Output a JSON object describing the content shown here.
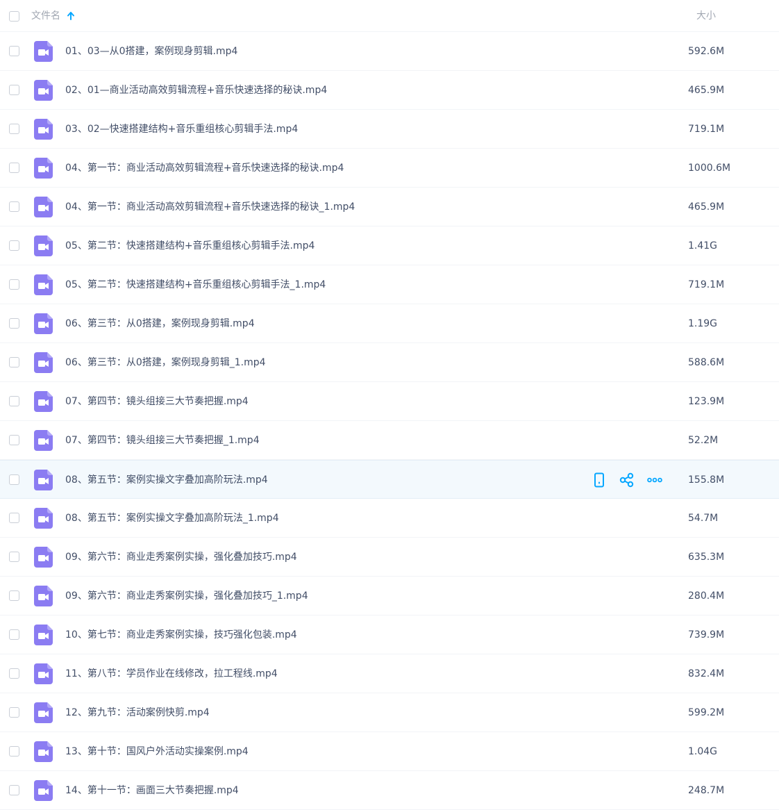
{
  "header": {
    "name_label": "文件名",
    "size_label": "大小",
    "sort_icon": "arrow-up-icon"
  },
  "colors": {
    "accent": "#06a7ff",
    "video_icon": "#8b7cf2",
    "hover_row": "#f3f9fd"
  },
  "files": [
    {
      "name": "01、03—从0搭建，案例现身剪辑.mp4",
      "size": "592.6M"
    },
    {
      "name": "02、01—商业活动高效剪辑流程+音乐快速选择的秘诀.mp4",
      "size": "465.9M"
    },
    {
      "name": "03、02—快速搭建结构+音乐重组核心剪辑手法.mp4",
      "size": "719.1M"
    },
    {
      "name": "04、第一节：商业活动高效剪辑流程+音乐快速选择的秘诀.mp4",
      "size": "1000.6M"
    },
    {
      "name": "04、第一节：商业活动高效剪辑流程+音乐快速选择的秘诀_1.mp4",
      "size": "465.9M"
    },
    {
      "name": "05、第二节：快速搭建结构+音乐重组核心剪辑手法.mp4",
      "size": "1.41G"
    },
    {
      "name": "05、第二节：快速搭建结构+音乐重组核心剪辑手法_1.mp4",
      "size": "719.1M"
    },
    {
      "name": "06、第三节：从0搭建，案例现身剪辑.mp4",
      "size": "1.19G"
    },
    {
      "name": "06、第三节：从0搭建，案例现身剪辑_1.mp4",
      "size": "588.6M"
    },
    {
      "name": "07、第四节：镜头组接三大节奏把握.mp4",
      "size": "123.9M"
    },
    {
      "name": "07、第四节：镜头组接三大节奏把握_1.mp4",
      "size": "52.2M"
    },
    {
      "name": "08、第五节：案例实操文字叠加高阶玩法.mp4",
      "size": "155.8M",
      "hover": true
    },
    {
      "name": "08、第五节：案例实操文字叠加高阶玩法_1.mp4",
      "size": "54.7M"
    },
    {
      "name": "09、第六节：商业走秀案例实操，强化叠加技巧.mp4",
      "size": "635.3M"
    },
    {
      "name": "09、第六节：商业走秀案例实操，强化叠加技巧_1.mp4",
      "size": "280.4M"
    },
    {
      "name": "10、第七节：商业走秀案例实操，技巧强化包装.mp4",
      "size": "739.9M"
    },
    {
      "name": "11、第八节：学员作业在线修改，拉工程线.mp4",
      "size": "832.4M"
    },
    {
      "name": "12、第九节：活动案例快剪.mp4",
      "size": "599.2M"
    },
    {
      "name": "13、第十节：国风户外活动实操案例.mp4",
      "size": "1.04G"
    },
    {
      "name": "14、第十一节：画面三大节奏把握.mp4",
      "size": "248.7M"
    }
  ],
  "row_actions": [
    {
      "icon": "phone-icon"
    },
    {
      "icon": "share-icon"
    },
    {
      "icon": "more-icon"
    }
  ]
}
